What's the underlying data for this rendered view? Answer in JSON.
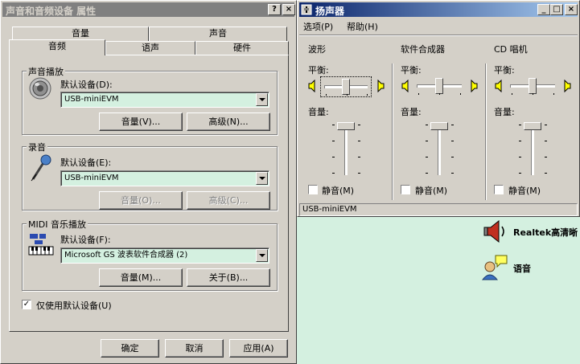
{
  "props": {
    "title": "声音和音频设备 属性",
    "title_btns": [
      "?",
      "×"
    ],
    "tabs_back": [
      "音量",
      "声音"
    ],
    "tabs_front": [
      "音频",
      "语声",
      "硬件"
    ],
    "playback": {
      "group": "声音播放",
      "label": "默认设备(D):",
      "device": "USB-miniEVM",
      "btn1": "音量(V)...",
      "btn2": "高级(N)..."
    },
    "record": {
      "group": "录音",
      "label": "默认设备(E):",
      "device": "USB-miniEVM",
      "btn1": "音量(O)...",
      "btn2": "高级(C)..."
    },
    "midi": {
      "group": "MIDI 音乐播放",
      "label": "默认设备(F):",
      "device": "Microsoft GS 波表软件合成器 (2)",
      "btn1": "音量(M)...",
      "btn2": "关于(B)..."
    },
    "only_default": "仅使用默认设备(U)",
    "only_default_checked": true,
    "ok": "确定",
    "cancel": "取消",
    "apply": "应用(A)"
  },
  "mixer": {
    "title": "扬声器",
    "title_btns": [
      "_",
      "□",
      "×"
    ],
    "menu": [
      "选项(P)",
      "帮助(H)"
    ],
    "channels": [
      {
        "name": "波形",
        "balance_label": "平衡:",
        "volume_label": "音量:",
        "mute_label": "静音(M)",
        "muted": false
      },
      {
        "name": "软件合成器",
        "balance_label": "平衡:",
        "volume_label": "音量:",
        "mute_label": "静音(M)",
        "muted": false
      },
      {
        "name": "CD 唱机",
        "balance_label": "平衡:",
        "volume_label": "音量:",
        "mute_label": "静音(M)",
        "muted": false
      }
    ],
    "status": "USB-miniEVM"
  },
  "desktop": {
    "icons": [
      {
        "label": "Realtek高清晰",
        "icon": "speaker-icon"
      },
      {
        "label": "语音",
        "icon": "speech-icon"
      }
    ]
  }
}
